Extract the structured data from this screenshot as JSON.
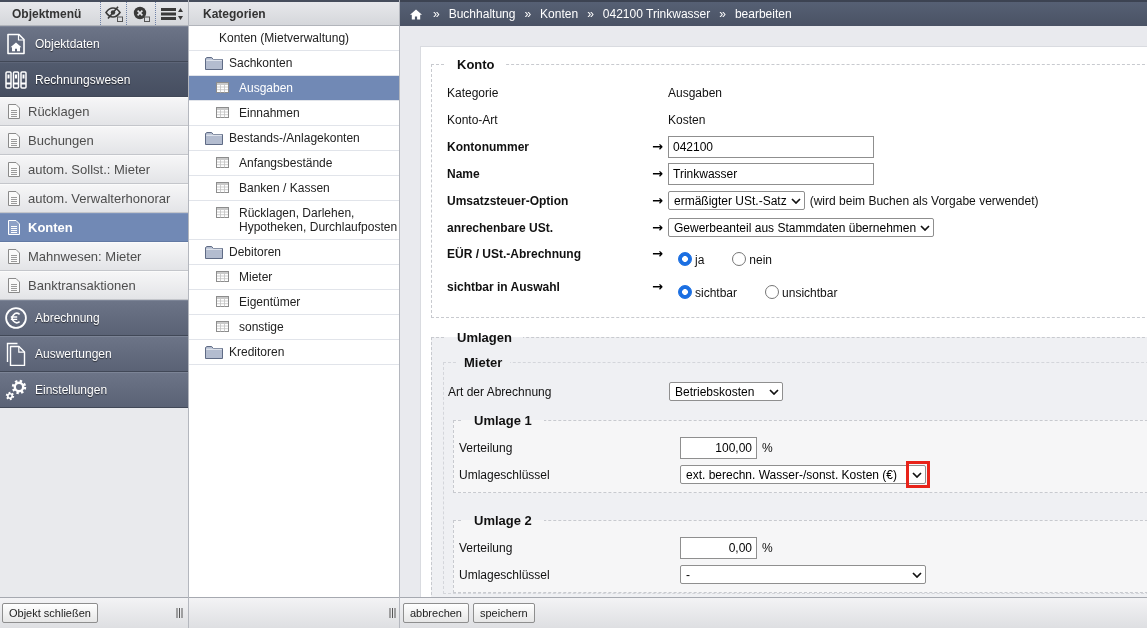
{
  "object_menu": {
    "title": "Objektmenü",
    "sections": [
      {
        "label": "Objektdaten",
        "expanded": false
      },
      {
        "label": "Rechnungswesen",
        "expanded": true,
        "items": [
          {
            "label": "Rücklagen",
            "selected": false
          },
          {
            "label": "Buchungen",
            "selected": false
          },
          {
            "label": "autom. Sollst.: Mieter",
            "selected": false
          },
          {
            "label": "autom. Verwalterhonorar",
            "selected": false
          },
          {
            "label": "Konten",
            "selected": true
          },
          {
            "label": "Mahnwesen: Mieter",
            "selected": false
          },
          {
            "label": "Banktransaktionen",
            "selected": false
          }
        ]
      },
      {
        "label": "Abrechnung",
        "expanded": false
      },
      {
        "label": "Auswertungen",
        "expanded": false
      },
      {
        "label": "Einstellungen",
        "expanded": false
      }
    ],
    "close_button": "Objekt schließen"
  },
  "categories": {
    "title": "Kategorien",
    "tree": [
      {
        "label": "Konten (Mietverwaltung)",
        "kind": "root",
        "selected": false,
        "children": [
          {
            "label": "Sachkonten",
            "kind": "folder",
            "selected": false,
            "children": [
              {
                "label": "Ausgaben",
                "kind": "list",
                "selected": true
              },
              {
                "label": "Einnahmen",
                "kind": "list",
                "selected": false
              }
            ]
          },
          {
            "label": "Bestands-/Anlagekonten",
            "kind": "folder",
            "selected": false,
            "children": [
              {
                "label": "Anfangsbestände",
                "kind": "list",
                "selected": false
              },
              {
                "label": "Banken / Kassen",
                "kind": "list",
                "selected": false
              },
              {
                "label": "Rücklagen, Darlehen, Hypotheken, Durchlaufposten",
                "kind": "list",
                "selected": false
              }
            ]
          },
          {
            "label": "Debitoren",
            "kind": "folder",
            "selected": false,
            "children": [
              {
                "label": "Mieter",
                "kind": "list",
                "selected": false
              },
              {
                "label": "Eigentümer",
                "kind": "list",
                "selected": false
              },
              {
                "label": "sonstige",
                "kind": "list",
                "selected": false
              }
            ]
          },
          {
            "label": "Kreditoren",
            "kind": "folder",
            "selected": false
          }
        ]
      }
    ]
  },
  "breadcrumb": [
    {
      "separator": "»",
      "label": "Buchhaltung"
    },
    {
      "separator": "»",
      "label": "Konten"
    },
    {
      "separator": "»",
      "label": "042100 Trinkwasser"
    },
    {
      "separator": "»",
      "label": "bearbeiten"
    }
  ],
  "account": {
    "legend": "Konto",
    "rows": [
      {
        "kind": "static",
        "label": "Kategorie",
        "value": "Ausgaben"
      },
      {
        "kind": "static",
        "label": "Konto-Art",
        "value": "Kosten"
      },
      {
        "kind": "text",
        "label": "Kontonummer",
        "arrow": "→",
        "value": "042100"
      },
      {
        "kind": "text",
        "label": "Name",
        "arrow": "→",
        "value": "Trinkwasser"
      },
      {
        "kind": "select",
        "label": "Umsatzsteuer-Option",
        "arrow": "→",
        "value": "ermäßigter USt.-Satz",
        "note": "(wird beim Buchen als Vorgabe verwendet)"
      },
      {
        "kind": "select",
        "label": "anrechenbare USt.",
        "arrow": "→",
        "value": "Gewerbeanteil aus Stammdaten übernehmen"
      },
      {
        "kind": "radio",
        "label": "EÜR / USt.-Abrechnung",
        "arrow": "→",
        "options": [
          {
            "label": "ja",
            "selected": true
          },
          {
            "label": "nein",
            "selected": false
          }
        ]
      },
      {
        "kind": "radio",
        "label": "sichtbar in Auswahl",
        "arrow": "→",
        "options": [
          {
            "label": "sichtbar",
            "selected": true
          },
          {
            "label": "unsichtbar",
            "selected": false
          }
        ]
      }
    ]
  },
  "apportionment": {
    "legend": "Umlagen",
    "tenant": {
      "legend": "Mieter",
      "billing": {
        "label": "Art der Abrechnung",
        "value": "Betriebskosten"
      },
      "splits": [
        {
          "legend": "Umlage 1",
          "share": {
            "label": "Verteilung",
            "value": "100,00",
            "unit": "%"
          },
          "key": {
            "label": "Umlageschlüssel",
            "value": "ext. berechn. Wasser-/sonst. Kosten (€)",
            "highlighted": true
          }
        },
        {
          "legend": "Umlage 2",
          "share": {
            "label": "Verteilung",
            "value": "0,00",
            "unit": "%"
          },
          "key": {
            "label": "Umlageschlüssel",
            "value": "-"
          }
        }
      ]
    }
  },
  "actions": [
    "abbrechen",
    "speichern"
  ]
}
